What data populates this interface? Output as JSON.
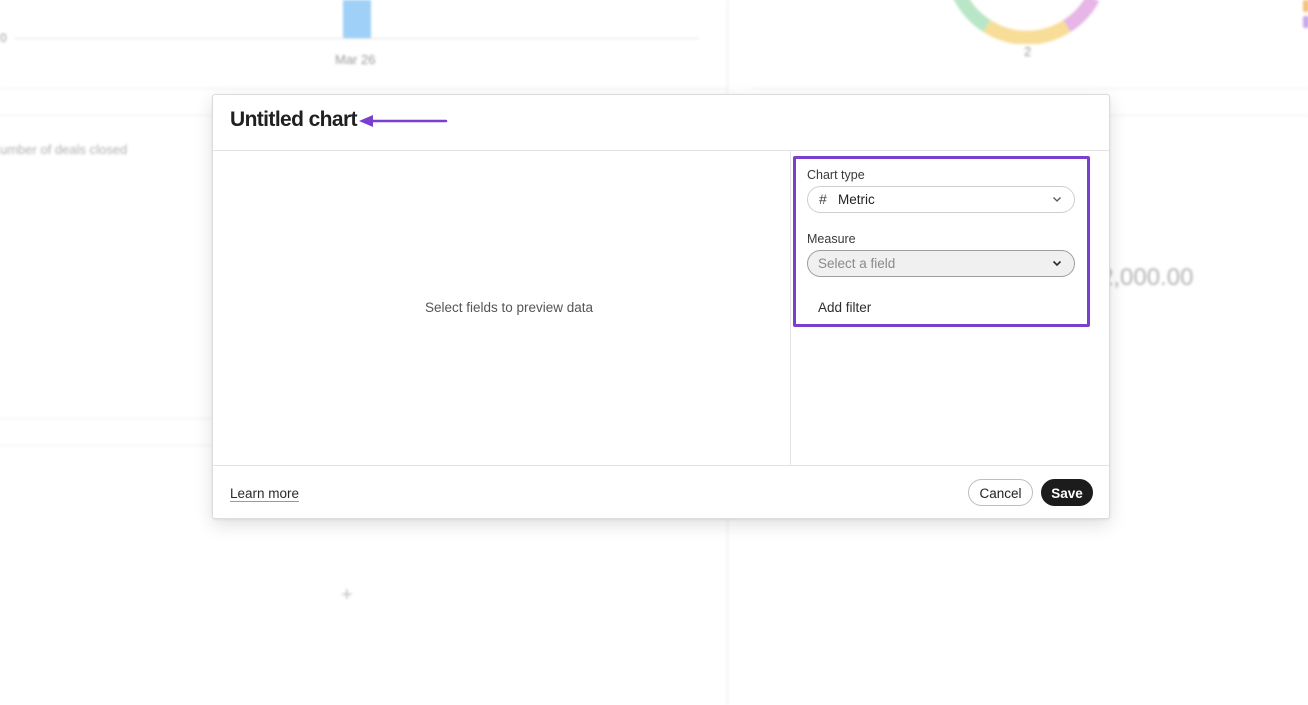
{
  "background": {
    "axis_zero_label": "0",
    "axis_tick_label": "Mar 26",
    "donut_label": "2",
    "card_title": "umber of deals closed",
    "big_number": "2,000.00",
    "add_icon_glyph": "+"
  },
  "modal": {
    "title": "Untitled chart",
    "preview_empty_text": "Select fields to preview data",
    "config": {
      "chart_type_label": "Chart type",
      "chart_type_icon": "#",
      "chart_type_value": "Metric",
      "measure_label": "Measure",
      "measure_placeholder": "Select a field",
      "add_filter_label": "Add filter"
    },
    "footer": {
      "learn_more_label": "Learn more",
      "cancel_label": "Cancel",
      "save_label": "Save"
    }
  },
  "colors": {
    "highlight": "#7a3fcf",
    "save_button_bg": "#1c1c1c",
    "bar_fill": "#9fd0f7"
  }
}
